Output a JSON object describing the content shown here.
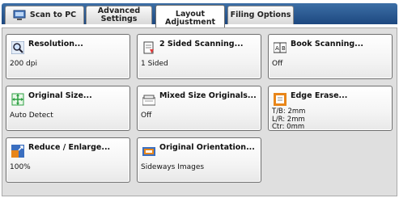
{
  "tabs": [
    {
      "label": "Scan to PC",
      "icon": "scan-to-pc-icon"
    },
    {
      "label": "Advanced\nSettings"
    },
    {
      "label": "Layout\nAdjustment",
      "active": true
    },
    {
      "label": "Filing Options"
    }
  ],
  "buttons": {
    "resolution": {
      "title": "Resolution...",
      "value": "200 dpi",
      "icon": "magnifier-icon"
    },
    "two_sided": {
      "title": "2 Sided Scanning...",
      "value": "1 Sided",
      "icon": "two-sided-icon"
    },
    "book": {
      "title": "Book Scanning...",
      "value": "Off",
      "icon": "book-icon",
      "icon_text": "A B"
    },
    "original_size": {
      "title": "Original Size...",
      "value": "Auto Detect",
      "icon": "original-size-icon"
    },
    "mixed_size": {
      "title": "Mixed Size Originals...",
      "value": "Off",
      "icon": "mixed-size-icon"
    },
    "edge_erase": {
      "title": "Edge Erase...",
      "values": [
        "T/B: 2mm",
        "L/R: 2mm",
        "Ctr: 0mm"
      ],
      "icon": "edge-erase-icon"
    },
    "reduce": {
      "title": "Reduce / Enlarge...",
      "value": "100%",
      "icon": "reduce-enlarge-icon"
    },
    "orientation": {
      "title": "Original Orientation...",
      "value": "Sideways Images",
      "icon": "orientation-icon"
    }
  },
  "colors": {
    "tab_bar": "#2b5a92",
    "panel": "#dfdfdf",
    "accent_orange": "#e8861a",
    "accent_green": "#2ea043"
  }
}
